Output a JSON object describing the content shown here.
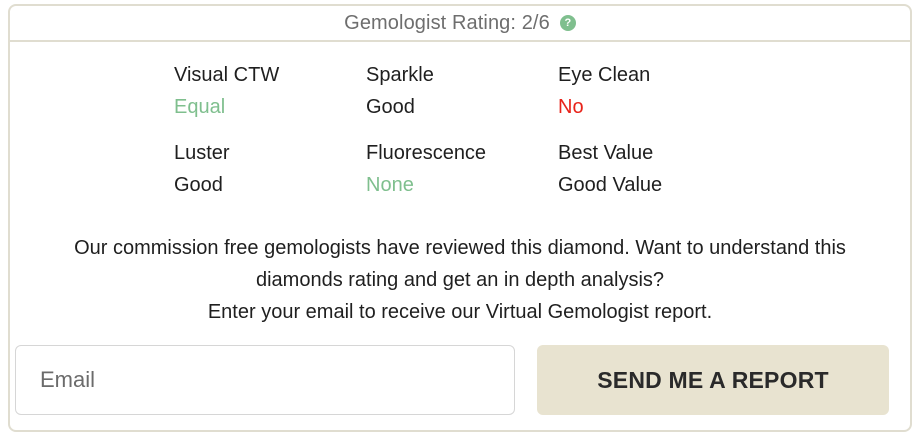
{
  "header": {
    "title": "Gemologist Rating: 2/6",
    "help_icon": "question-mark-icon",
    "help_glyph": "?"
  },
  "ratings": [
    {
      "label": "Visual CTW",
      "value": "Equal",
      "status": "good"
    },
    {
      "label": "Sparkle",
      "value": "Good",
      "status": "neutral"
    },
    {
      "label": "Eye Clean",
      "value": "No",
      "status": "bad"
    },
    {
      "label": "Luster",
      "value": "Good",
      "status": "neutral"
    },
    {
      "label": "Fluorescence",
      "value": "None",
      "status": "good"
    },
    {
      "label": "Best Value",
      "value": "Good Value",
      "status": "neutral"
    }
  ],
  "description": {
    "line1": "Our commission free gemologists have reviewed this diamond. Want to understand this",
    "line2": "diamonds rating and get an in depth analysis?",
    "line3": "Enter your email to receive our Virtual Gemologist report."
  },
  "form": {
    "email_placeholder": "Email",
    "email_value": "",
    "submit_label": "SEND ME A REPORT"
  },
  "colors": {
    "good": "#7fbf8e",
    "bad": "#e8231a",
    "neutral": "#1f1f1f",
    "button_bg": "#e8e3d0",
    "border": "#e0ddd0"
  }
}
